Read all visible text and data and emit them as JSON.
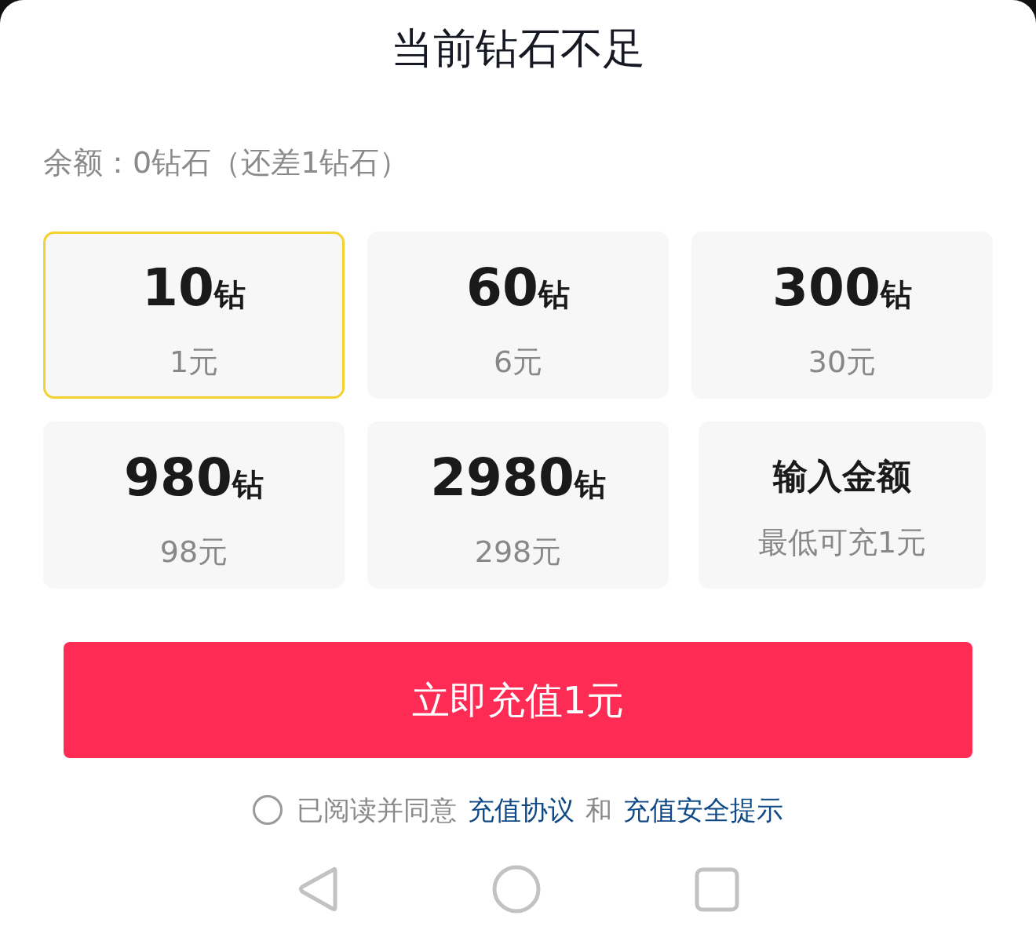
{
  "sheet": {
    "title": "当前钻石不足",
    "balance": "余额：0钻石（还差1钻石）"
  },
  "packages": [
    {
      "kind": "preset",
      "amount": "10",
      "unit": "钻",
      "price": "1元",
      "selected": true
    },
    {
      "kind": "preset",
      "amount": "60",
      "unit": "钻",
      "price": "6元",
      "selected": false
    },
    {
      "kind": "preset",
      "amount": "300",
      "unit": "钻",
      "price": "30元",
      "selected": false
    },
    {
      "kind": "preset",
      "amount": "980",
      "unit": "钻",
      "price": "98元",
      "selected": false
    },
    {
      "kind": "preset",
      "amount": "2980",
      "unit": "钻",
      "price": "298元",
      "selected": false
    },
    {
      "kind": "custom",
      "label": "输入金额",
      "hint": "最低可充1元",
      "selected": false
    }
  ],
  "pay_button": {
    "label": "立即充值1元"
  },
  "agreement": {
    "checked": false,
    "parts": [
      {
        "kind": "plain",
        "text": "已阅读并同意"
      },
      {
        "kind": "link",
        "text": "充值协议"
      },
      {
        "kind": "plain",
        "text": "和"
      },
      {
        "kind": "link",
        "text": "充值安全提示"
      }
    ]
  }
}
